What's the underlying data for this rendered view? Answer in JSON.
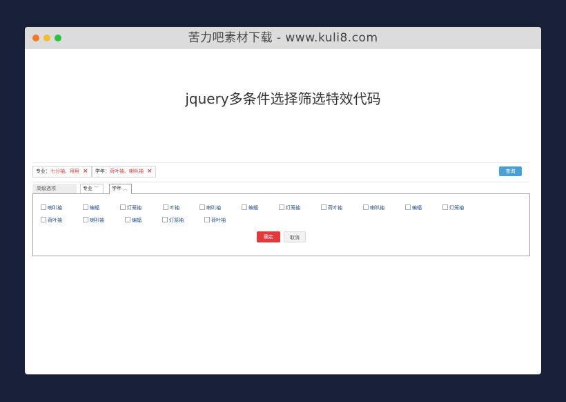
{
  "window": {
    "title": "苦力吧素材下载 - www.kuli8.com"
  },
  "page": {
    "heading": "jquery多条件选择筛选特效代码"
  },
  "filter_bar": {
    "chips": [
      {
        "key": "专业：",
        "value": "七分袖、用用",
        "remove": "×"
      },
      {
        "key": "学年：",
        "value": "荷叶袖、喇叭袖",
        "remove": "×"
      }
    ],
    "search_label": "查询"
  },
  "tabs": {
    "advanced_label": "高级选项",
    "items": [
      {
        "label": "专业",
        "chevron": "﹀"
      },
      {
        "label": "学年",
        "chevron": "︿"
      }
    ]
  },
  "options": {
    "row1": [
      "喇叭袖",
      "蝙蝠",
      "灯笼袖",
      "叶袖",
      "喇叭袖",
      "蝙蝠",
      "灯笼袖",
      "荷叶袖",
      "喇叭袖",
      "蝙蝠",
      "灯笼袖"
    ],
    "row2": [
      "荷叶袖",
      "喇叭袖",
      "蝙蝠",
      "灯笼袖",
      "荷叶袖"
    ]
  },
  "actions": {
    "confirm_label": "确定",
    "cancel_label": "取消"
  },
  "colors": {
    "accent_red": "#e4393c",
    "accent_blue": "#4aa0d3",
    "option_text": "#1d4b8f"
  }
}
